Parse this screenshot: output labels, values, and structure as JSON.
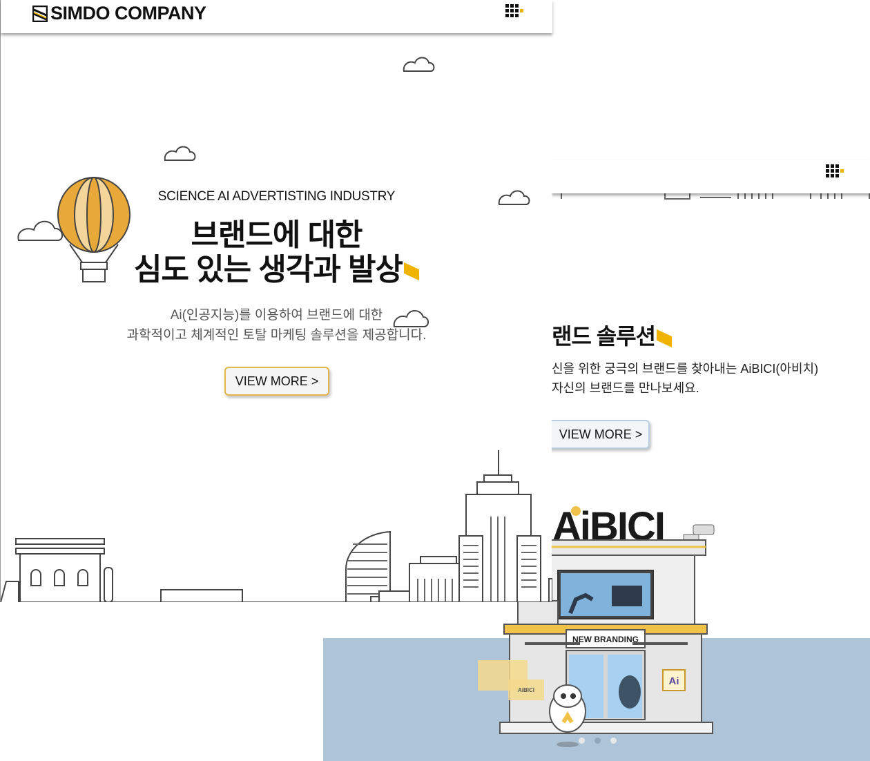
{
  "panel1": {
    "logo_text": "SIMDO COMPANY",
    "kicker": "SCIENCE AI ADVERTISTING INDUSTRY",
    "headline_line1": "브랜드에 대한",
    "headline_line2": "심도 있는 생각과 발상",
    "sub_line1": "Ai(인공지능)를 이용하여 브랜드에 대한",
    "sub_line2": "과학적이고 체계적인 토탈 마케팅 솔루션을 제공합니다.",
    "button_label": "VIEW MORE >",
    "menu_icon": "grid-menu-icon"
  },
  "panel2": {
    "title": "랜드 솔루션",
    "desc_line1": "신을 위한 궁극의 브랜드를 찾아내는 AiBICI(아비치)",
    "desc_line2": "자신의 브랜드를 만나보세요.",
    "button_label": "VIEW MORE >",
    "menu_icon": "grid-menu-icon"
  },
  "store": {
    "sign": "AiBICI",
    "banner": "NEW BRANDING",
    "window_badge": "Ai",
    "poster_text": "AiBICI"
  },
  "slider": {
    "dot_count": 3,
    "active_index": 1
  },
  "colors": {
    "accent": "#f0b400",
    "balloon": "#e8a93a",
    "stage": "#adc4d9",
    "button2_border": "#b9cde0",
    "button1_border": "#e4b64a"
  }
}
